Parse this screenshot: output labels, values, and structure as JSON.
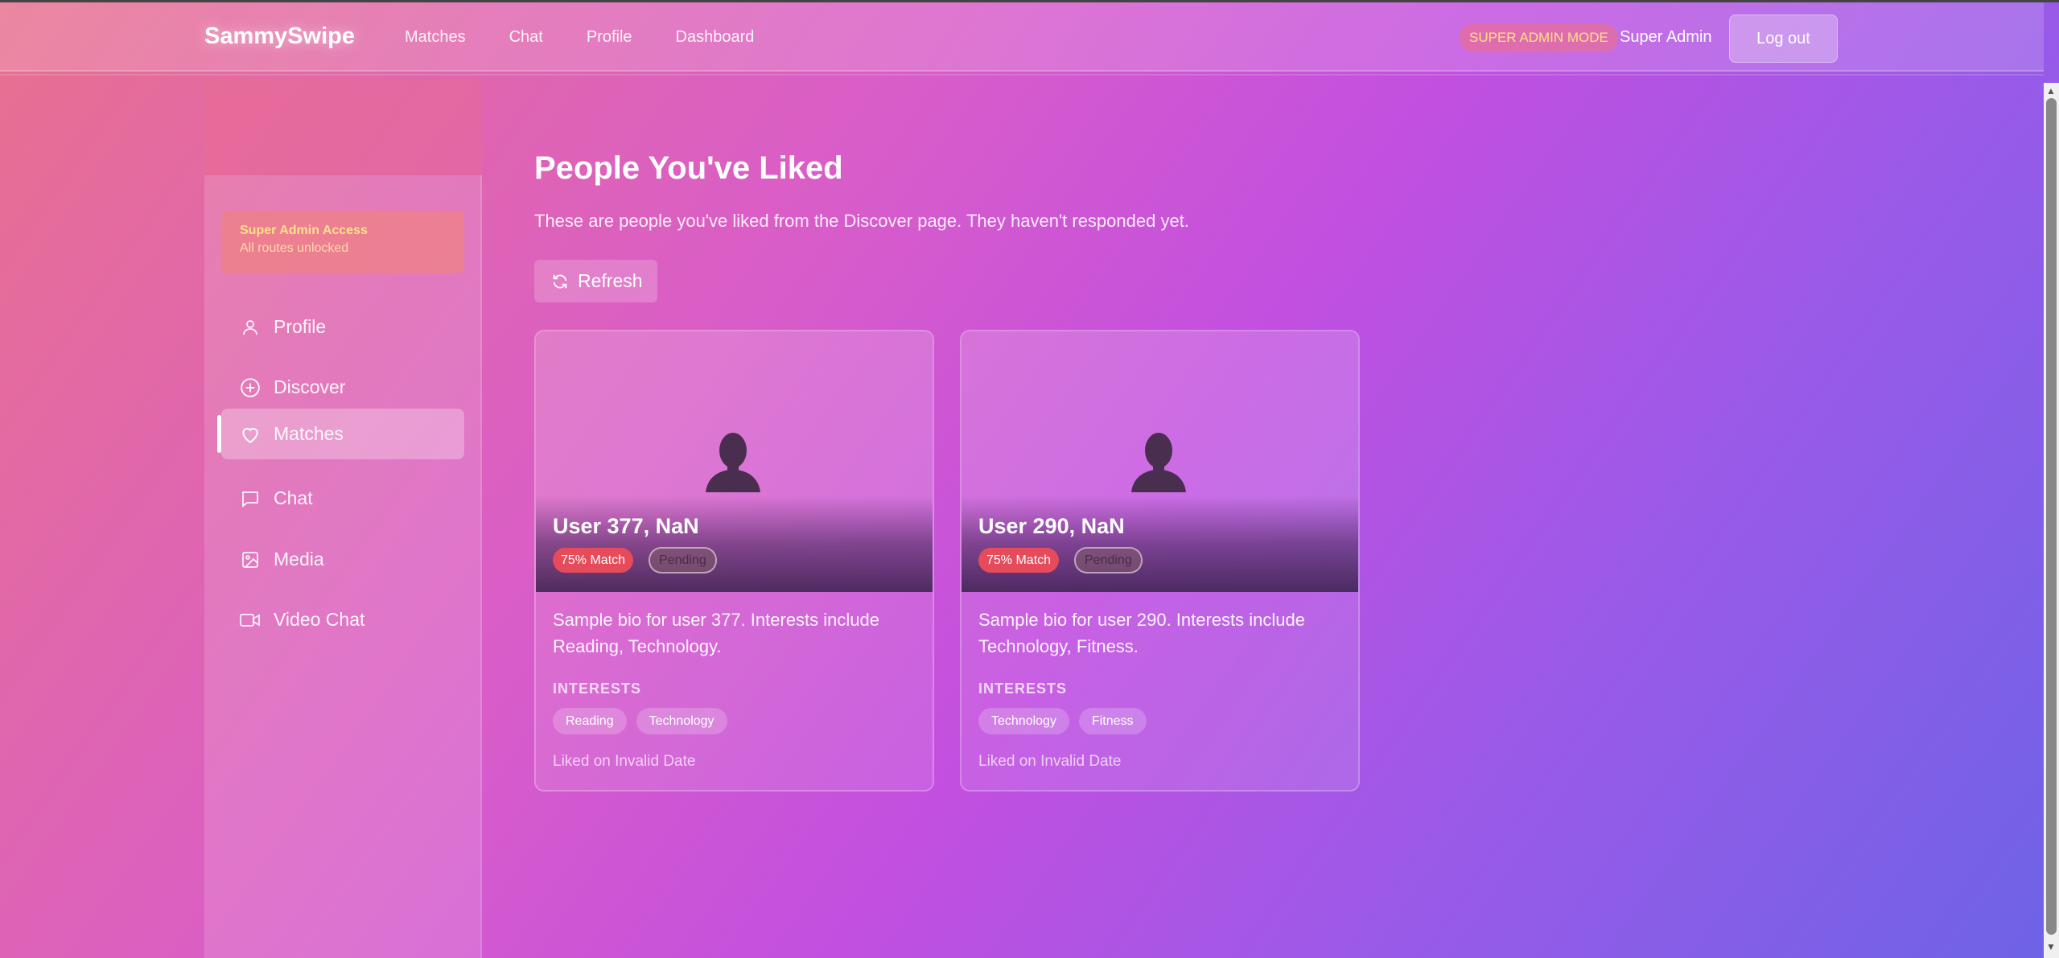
{
  "navbar": {
    "brand": "SammySwipe",
    "links": [
      "Matches",
      "Chat",
      "Profile",
      "Dashboard"
    ],
    "admin_badge": "SUPER ADMIN MODE",
    "user_name": "Super Admin",
    "logout_label": "Log out"
  },
  "sidebar": {
    "access_title": "Super Admin Access",
    "access_sub": "All routes unlocked",
    "items": [
      {
        "label": "Profile",
        "icon": "user-icon"
      },
      {
        "label": "Discover",
        "icon": "plus-circle-icon"
      },
      {
        "label": "Matches",
        "icon": "heart-icon",
        "active": true
      },
      {
        "label": "Chat",
        "icon": "message-icon"
      },
      {
        "label": "Media",
        "icon": "image-icon"
      },
      {
        "label": "Video Chat",
        "icon": "video-icon"
      }
    ]
  },
  "main": {
    "title": "People You've Liked",
    "subtitle": "These are people you've liked from the Discover page. They haven't responded yet.",
    "refresh_label": "Refresh",
    "interests_label": "INTERESTS",
    "cards": [
      {
        "name": "User 377, NaN",
        "match": "75% Match",
        "status": "Pending",
        "bio": "Sample bio for user 377. Interests include Reading, Technology.",
        "interests": [
          "Reading",
          "Technology"
        ],
        "liked": "Liked on Invalid Date"
      },
      {
        "name": "User 290, NaN",
        "match": "75% Match",
        "status": "Pending",
        "bio": "Sample bio for user 290. Interests include Technology, Fitness.",
        "interests": [
          "Technology",
          "Fitness"
        ],
        "liked": "Liked on Invalid Date"
      }
    ]
  },
  "colors": {
    "accent_badge": "#e54b5a",
    "admin_text": "#ffe08a"
  }
}
